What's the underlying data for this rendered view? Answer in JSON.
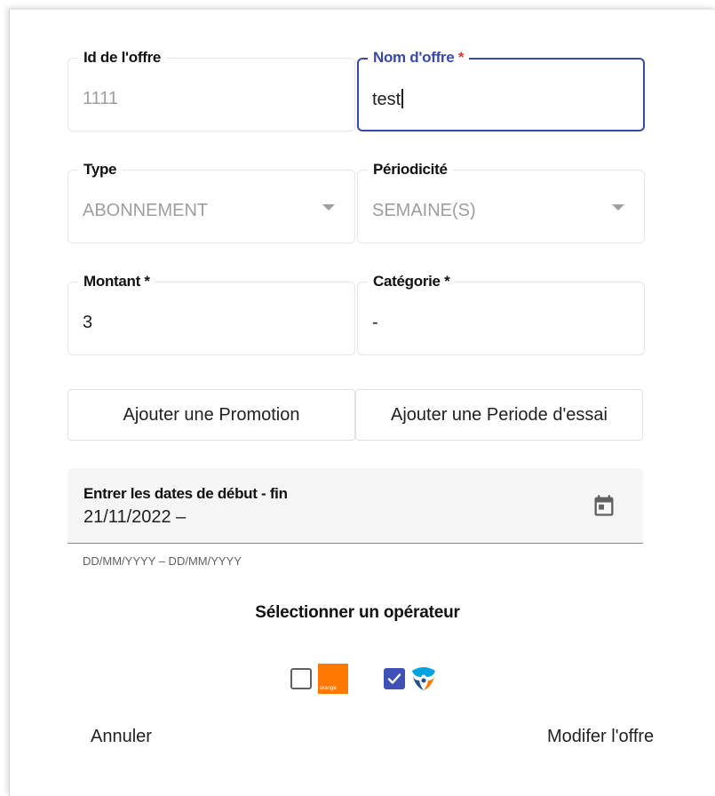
{
  "form": {
    "id_offer": {
      "label": "Id de l'offre",
      "value": "1111"
    },
    "offer_name": {
      "label": "Nom d'offre",
      "required_mark": "*",
      "value": "test"
    },
    "type": {
      "label": "Type",
      "value": "ABONNEMENT"
    },
    "periodicity": {
      "label": "Périodicité",
      "value": "SEMAINE(S)"
    },
    "amount": {
      "label": "Montant *",
      "value": "3"
    },
    "category": {
      "label": "Catégorie *",
      "value": "-"
    }
  },
  "buttons": {
    "add_promotion": "Ajouter une Promotion",
    "add_trial": "Ajouter une Periode d'essai"
  },
  "date_range": {
    "label": "Entrer les dates de début - fin",
    "value": "21/11/2022 –",
    "hint": "DD/MM/YYYY – DD/MM/YYYY"
  },
  "operators": {
    "title": "Sélectionner un opérateur",
    "items": [
      {
        "name": "orange",
        "logo_text": "orange",
        "checked": false,
        "color": "#ff7900"
      },
      {
        "name": "bouygues",
        "checked": true,
        "color": "#3f51b5"
      }
    ]
  },
  "footer": {
    "cancel_label": "Annuler",
    "submit_label": "Modifer l'offre"
  },
  "colors": {
    "accent": "#3949ab",
    "checkbox_checked": "#3f51b5",
    "required": "#e53935",
    "orange_brand": "#ff7900",
    "bouygues_blue": "#1d4f91",
    "bouygues_cyan": "#00a3e0"
  }
}
